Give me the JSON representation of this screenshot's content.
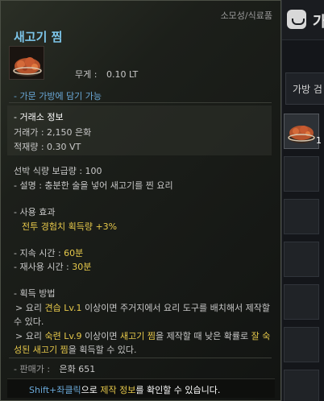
{
  "inventory": {
    "header_text": "가",
    "tab_label": "가방 검",
    "first_slot_count": "1"
  },
  "tooltip": {
    "category": "소모성/식료품",
    "title": "새고기 찜",
    "weight_label": "무게 :",
    "weight_value": "0.10 LT",
    "bag_note": "- 가문 가방에 담기 가능",
    "market_title": "- 거래소 정보",
    "market_price": "거래가 : 2,150 은화",
    "market_weight": "적재량 : 0.30 VT",
    "food_supply": "선박 식량 보급량 : 100",
    "description": "- 설명 : 충분한 술을 넣어 새고기를 찐 요리",
    "effect_title": "- 사용 효과",
    "effect_value": "전투 경험치 획득량 +3%",
    "duration_label": "- 지속 시간 :",
    "duration_value": "60분",
    "cooldown_label": "- 재사용 시간 :",
    "cooldown_value": "30분",
    "obtain_title": "- 획득 방법",
    "obtain1_prefix": "> 요리 ",
    "obtain1_skill": "견습 Lv.1",
    "obtain1_suffix": " 이상이면 주거지에서 요리 도구를 배치해서 제작할",
    "obtain1_line2": "수 있다.",
    "obtain2_prefix": "> 요리 ",
    "obtain2_skill": "숙련 Lv.9",
    "obtain2_mid1": " 이상이면 ",
    "obtain2_item": "새고기 찜",
    "obtain2_mid2": "을 제작할 때 낮은 확률로 ",
    "obtain2_rare": "잘 숙",
    "obtain2_rare2": "성된 새고기 찜",
    "obtain2_end": "을 획득할 수 있다.",
    "sell_label": "- 판매가 :",
    "sell_value": "은화 651",
    "footer_key": "Shift+좌클릭",
    "footer_mid": "으로 ",
    "footer_link": "제작 정보",
    "footer_end": "를 확인할 수 있습니다."
  }
}
